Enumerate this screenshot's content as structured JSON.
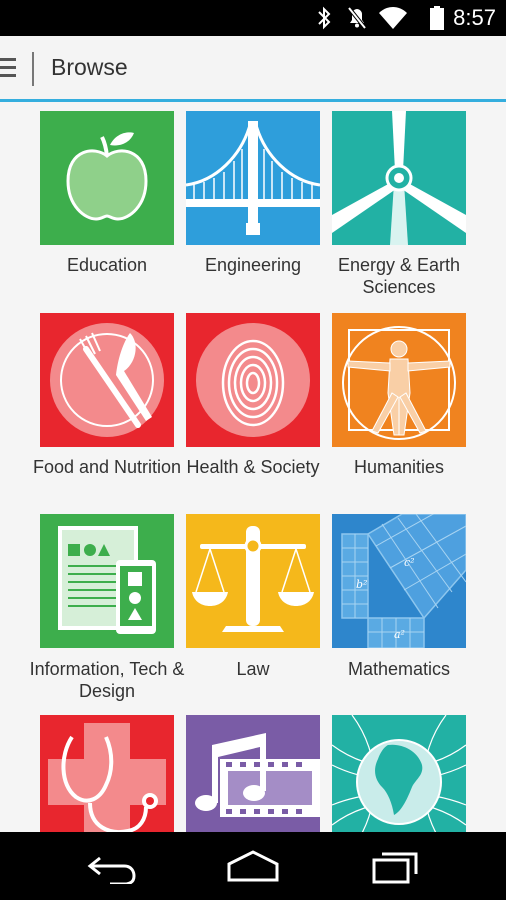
{
  "status_bar": {
    "time": "8:57",
    "icons": [
      "bluetooth-icon",
      "mute-icon",
      "wifi-icon",
      "battery-icon"
    ]
  },
  "app_bar": {
    "title": "Browse"
  },
  "categories": [
    {
      "label": "Education",
      "color": "#3dae4c"
    },
    {
      "label": "Engineering",
      "color": "#2e9edb"
    },
    {
      "label": "Energy & Earth Sciences",
      "color": "#22b1a4"
    },
    {
      "label": "Food and Nutrition",
      "color": "#e8262e"
    },
    {
      "label": "Health & Society",
      "color": "#e8262e"
    },
    {
      "label": "Humanities",
      "color": "#f0831f"
    },
    {
      "label": "Information, Tech & Design",
      "color": "#3dae4c"
    },
    {
      "label": "Law",
      "color": "#f5b81b"
    },
    {
      "label": "Mathematics",
      "color": "#2e86cc"
    },
    {
      "label": "",
      "color": "#e8262e"
    },
    {
      "label": "",
      "color": "#7a5ca6"
    },
    {
      "label": "",
      "color": "#22b1a4"
    }
  ],
  "nav_bar": {
    "buttons": [
      "back-icon",
      "home-icon",
      "recent-apps-icon"
    ]
  }
}
